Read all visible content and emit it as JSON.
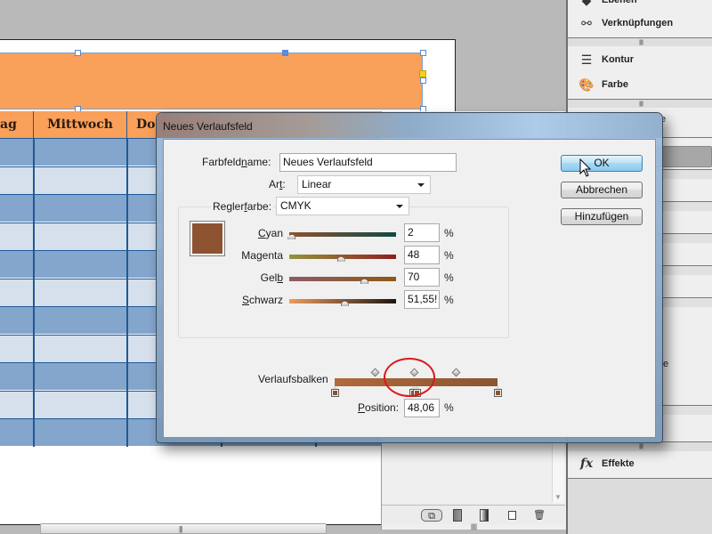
{
  "document": {
    "table": {
      "headers": [
        "ag",
        "Mittwoch",
        "Do"
      ],
      "row_count": 11
    }
  },
  "swatches_panel": {
    "toolbar_icons": [
      "show-all-swatches-icon",
      "show-color-swatches-icon",
      "show-gradient-swatches-icon",
      "new-swatch-icon",
      "delete-swatch-icon"
    ]
  },
  "dock": {
    "items": [
      {
        "label": "Ebenen",
        "icon": "layers-icon"
      },
      {
        "label": "Verknüpfungen",
        "icon": "links-icon"
      },
      {
        "label": "Kontur",
        "icon": "stroke-icon"
      },
      {
        "label": "Farbe",
        "icon": "color-palette-icon"
      },
      {
        "label": "Effekte",
        "icon": "fx-icon"
      }
    ],
    "partial_labels": [
      "e",
      "te"
    ]
  },
  "dialog": {
    "title": "Neues Verlaufsfeld",
    "swatch_name": {
      "label_pre": "Farbfeld",
      "label_u": "n",
      "label_post": "ame:",
      "value": "Neues Verlaufsfeld"
    },
    "type": {
      "label_pre": "Ar",
      "label_u": "t",
      "label_post": ":",
      "value": "Linear"
    },
    "stop_color": {
      "label_pre": "Regler",
      "label_u": "f",
      "label_post": "arbe:",
      "value": "CMYK"
    },
    "swatch_color": "#8d5230",
    "channels": [
      {
        "label_pre": "",
        "label_u": "C",
        "label_post": "yan",
        "value": "2",
        "unit": "%",
        "percent": 2,
        "gradient_from": "#8d5230",
        "gradient_to": "#0f4a44"
      },
      {
        "label_pre": "Ma",
        "label_u": "g",
        "label_post": "enta",
        "value": "48",
        "unit": "%",
        "percent": 48,
        "gradient_from": "#92963c",
        "gradient_to": "#8f1c22"
      },
      {
        "label_pre": "Gel",
        "label_u": "b",
        "label_post": "",
        "value": "70",
        "unit": "%",
        "percent": 70,
        "gradient_from": "#8d5a6a",
        "gradient_to": "#8d5a16"
      },
      {
        "label_pre": "",
        "label_u": "S",
        "label_post": "chwarz",
        "value": "51,55!",
        "unit": "%",
        "percent": 51.55,
        "gradient_from": "#f09a5a",
        "gradient_to": "#1a1612"
      }
    ],
    "gradient_ramp": {
      "label": "Verlaufsbalken",
      "from_color": "#b06a3c",
      "to_color": "#8a5530",
      "stops_percent": [
        0,
        48.06,
        50,
        100
      ],
      "midpoints_percent": [
        25,
        49,
        75
      ],
      "highlighted": true
    },
    "position": {
      "label_pre": "",
      "label_u": "P",
      "label_post": "osition:",
      "value": "48,06",
      "unit": "%"
    },
    "buttons": {
      "ok": "OK",
      "cancel": "Abbrechen",
      "add": "Hinzufügen"
    }
  }
}
